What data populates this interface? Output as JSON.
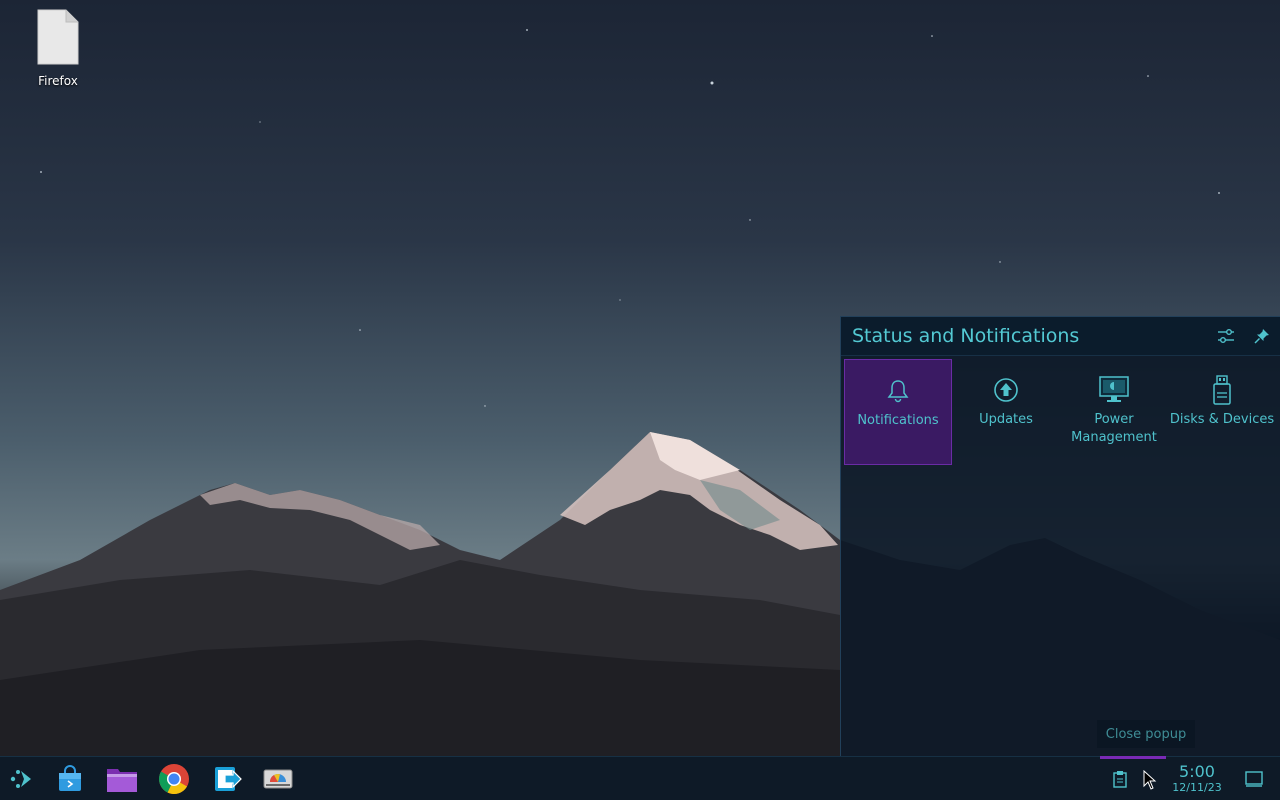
{
  "desktop": {
    "icons": [
      {
        "label": "Firefox",
        "icon": "file-icon"
      }
    ]
  },
  "popup": {
    "title": "Status and Notifications",
    "header_buttons": [
      "configure-icon",
      "pin-icon"
    ],
    "tiles": [
      {
        "label": "Notifications",
        "icon": "bell-icon",
        "active": true
      },
      {
        "label": "Updates",
        "icon": "update-icon",
        "active": false
      },
      {
        "label": "Power Management",
        "icon": "monitor-icon",
        "active": false
      },
      {
        "label": "Disks & Devices",
        "icon": "usb-drive-icon",
        "active": false
      }
    ],
    "tooltip": "Close popup"
  },
  "taskbar": {
    "launchers": [
      "app-launcher-icon",
      "discover-store-icon",
      "file-manager-icon",
      "chrome-icon",
      "remote-desktop-icon",
      "disk-usage-icon"
    ],
    "tray": [
      "clipboard-icon"
    ],
    "clock": {
      "time": "5:00",
      "date": "12/11/23"
    },
    "show_desktop": "show-desktop-icon"
  },
  "colors": {
    "accent": "#4fc2cc",
    "active_tile": "#3a1a63",
    "active_border": "#6a2ca5",
    "panel_bg": "#0e1a27"
  }
}
